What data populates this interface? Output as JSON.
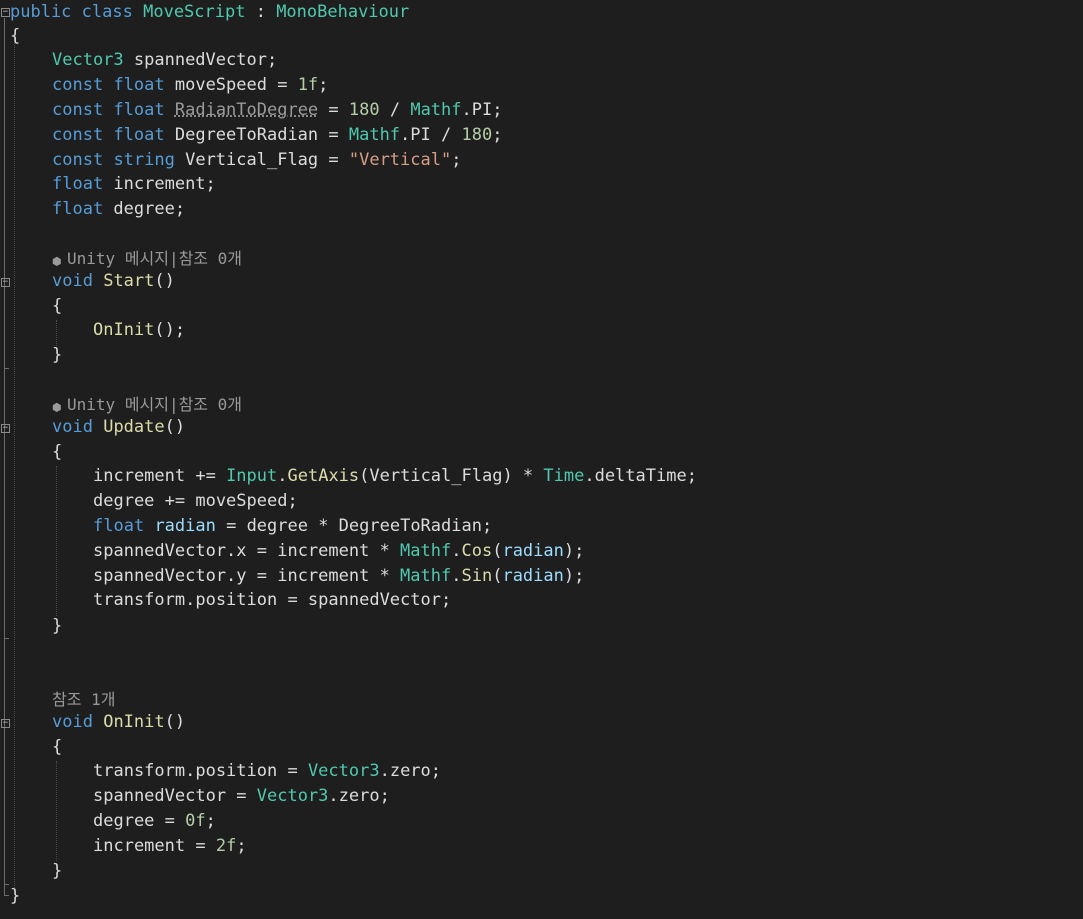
{
  "editor": {
    "class_decl": {
      "kw_public": "public",
      "kw_class": "class",
      "class_name": "MoveScript",
      "sep": " : ",
      "base": "MonoBehaviour"
    },
    "braces": {
      "open": "{",
      "close": "}"
    },
    "fields": {
      "f1": {
        "type": "Vector3",
        "rest": " spannedVector;"
      },
      "f2": {
        "k1": "const",
        "k2": "float",
        "rest1": " moveSpeed = ",
        "num": "1f",
        "rest2": ";"
      },
      "f3": {
        "k1": "const",
        "k2": "float",
        "name": "RadianToDegree",
        "eq": " = ",
        "num": "180",
        "div": " / ",
        "type": "Mathf",
        "rest": ".PI;"
      },
      "f4": {
        "k1": "const",
        "k2": "float",
        "name": " DegreeToRadian = ",
        "type": "Mathf",
        "rest": ".PI / ",
        "num": "180",
        "end": ";"
      },
      "f5": {
        "k1": "const",
        "k2": "string",
        "name": " Vertical_Flag = ",
        "str": "\"Vertical\"",
        "end": ";"
      },
      "f6": {
        "k": "float",
        "rest": " increment;"
      },
      "f7": {
        "k": "float",
        "rest": " degree;"
      }
    },
    "lens_start": "Unity 메시지|참조 0개",
    "lens_update": "Unity 메시지|참조 0개",
    "lens_oninit": "참조 1개",
    "start_method": {
      "kw": "void",
      "name": "Start",
      "parens": "()",
      "call_name": "OnInit",
      "call_rest": "();"
    },
    "update_method": {
      "kw": "void",
      "name": "Update",
      "parens": "()",
      "l1": {
        "a": "increment += ",
        "t1": "Input",
        "dot1": ".",
        "fn1": "GetAxis",
        "b": "(Vertical_Flag) * ",
        "t2": "Time",
        "c": ".deltaTime;"
      },
      "l2": "degree += moveSpeed;",
      "l3": {
        "k": "float",
        "var": "radian",
        "rest": " = degree * DegreeToRadian;"
      },
      "l4": {
        "a": "spannedVector.x = increment * ",
        "t": "Mathf",
        "dot": ".",
        "fn": "Cos",
        "p1": "(",
        "param": "radian",
        "p2": ");"
      },
      "l5": {
        "a": "spannedVector.y = increment * ",
        "t": "Mathf",
        "dot": ".",
        "fn": "Sin",
        "p1": "(",
        "param": "radian",
        "p2": ");"
      },
      "l6": "transform.position = spannedVector;"
    },
    "oninit_method": {
      "kw": "void",
      "name": "OnInit",
      "parens": "()",
      "l1": {
        "a": "transform.position = ",
        "t": "Vector3",
        "b": ".zero;"
      },
      "l2": {
        "a": "spannedVector = ",
        "t": "Vector3",
        "b": ".zero;"
      },
      "l3": {
        "a": "degree = ",
        "num": "0f",
        "b": ";"
      },
      "l4": {
        "a": "increment = ",
        "num": "2f",
        "b": ";"
      }
    }
  }
}
